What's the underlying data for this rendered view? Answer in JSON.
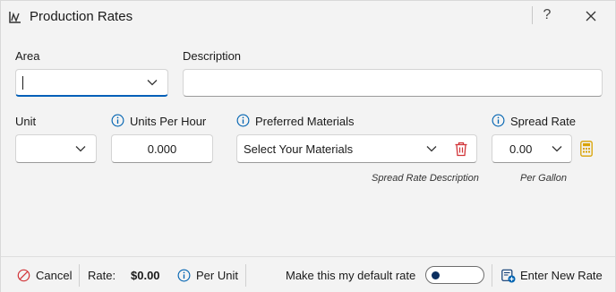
{
  "window": {
    "title": "Production Rates",
    "help_label": "?"
  },
  "form": {
    "area": {
      "label": "Area",
      "value": ""
    },
    "description": {
      "label": "Description",
      "value": ""
    },
    "unit": {
      "label": "Unit",
      "value": ""
    },
    "units_per_hour": {
      "label": "Units Per Hour",
      "value": "0.000"
    },
    "preferred_materials": {
      "label": "Preferred Materials",
      "placeholder": "Select Your Materials",
      "hint": "Spread Rate Description"
    },
    "spread_rate": {
      "label": "Spread Rate",
      "value": "0.00",
      "hint": "Per Gallon"
    }
  },
  "footer": {
    "cancel_label": "Cancel",
    "rate_label": "Rate:",
    "rate_value": "$0.00",
    "per_unit_label": "Per Unit",
    "default_rate_label": "Make this my default rate",
    "default_rate_on": false,
    "enter_new_rate_label": "Enter New Rate"
  },
  "colors": {
    "accent": "#005fb8",
    "info_icon": "#0063b1",
    "delete_icon": "#d13438",
    "calculator_icon": "#d9a200",
    "cancel_icon": "#d13438"
  }
}
